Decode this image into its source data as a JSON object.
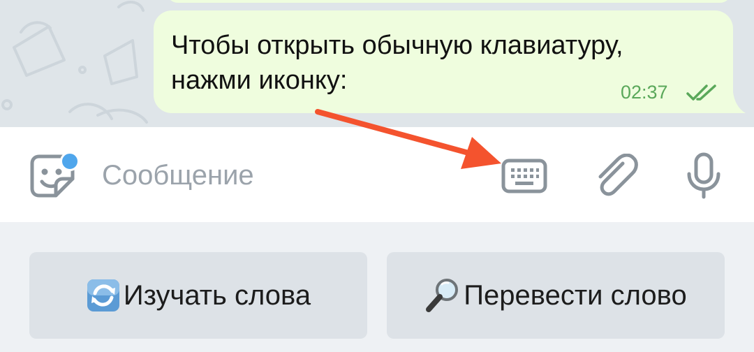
{
  "message": {
    "line1": "Чтобы открыть обычную клавиатуру,",
    "line2": "нажми иконку:",
    "time": "02:37",
    "status": "read"
  },
  "input": {
    "placeholder": "Сообщение"
  },
  "keyboard": {
    "buttons": [
      {
        "label": "Изучать слова",
        "icon": "refresh-emoji"
      },
      {
        "label": "Перевести слово",
        "icon": "magnifier-emoji"
      }
    ]
  },
  "icons": {
    "sticker": "sticker-icon",
    "keyboard": "keyboard-icon",
    "attach": "paperclip-icon",
    "voice": "microphone-icon"
  },
  "colors": {
    "bubble": "#effdde",
    "time": "#5aa85a",
    "badge": "#4fa6ec",
    "arrow": "#f4532e",
    "icon": "#8a939b"
  }
}
